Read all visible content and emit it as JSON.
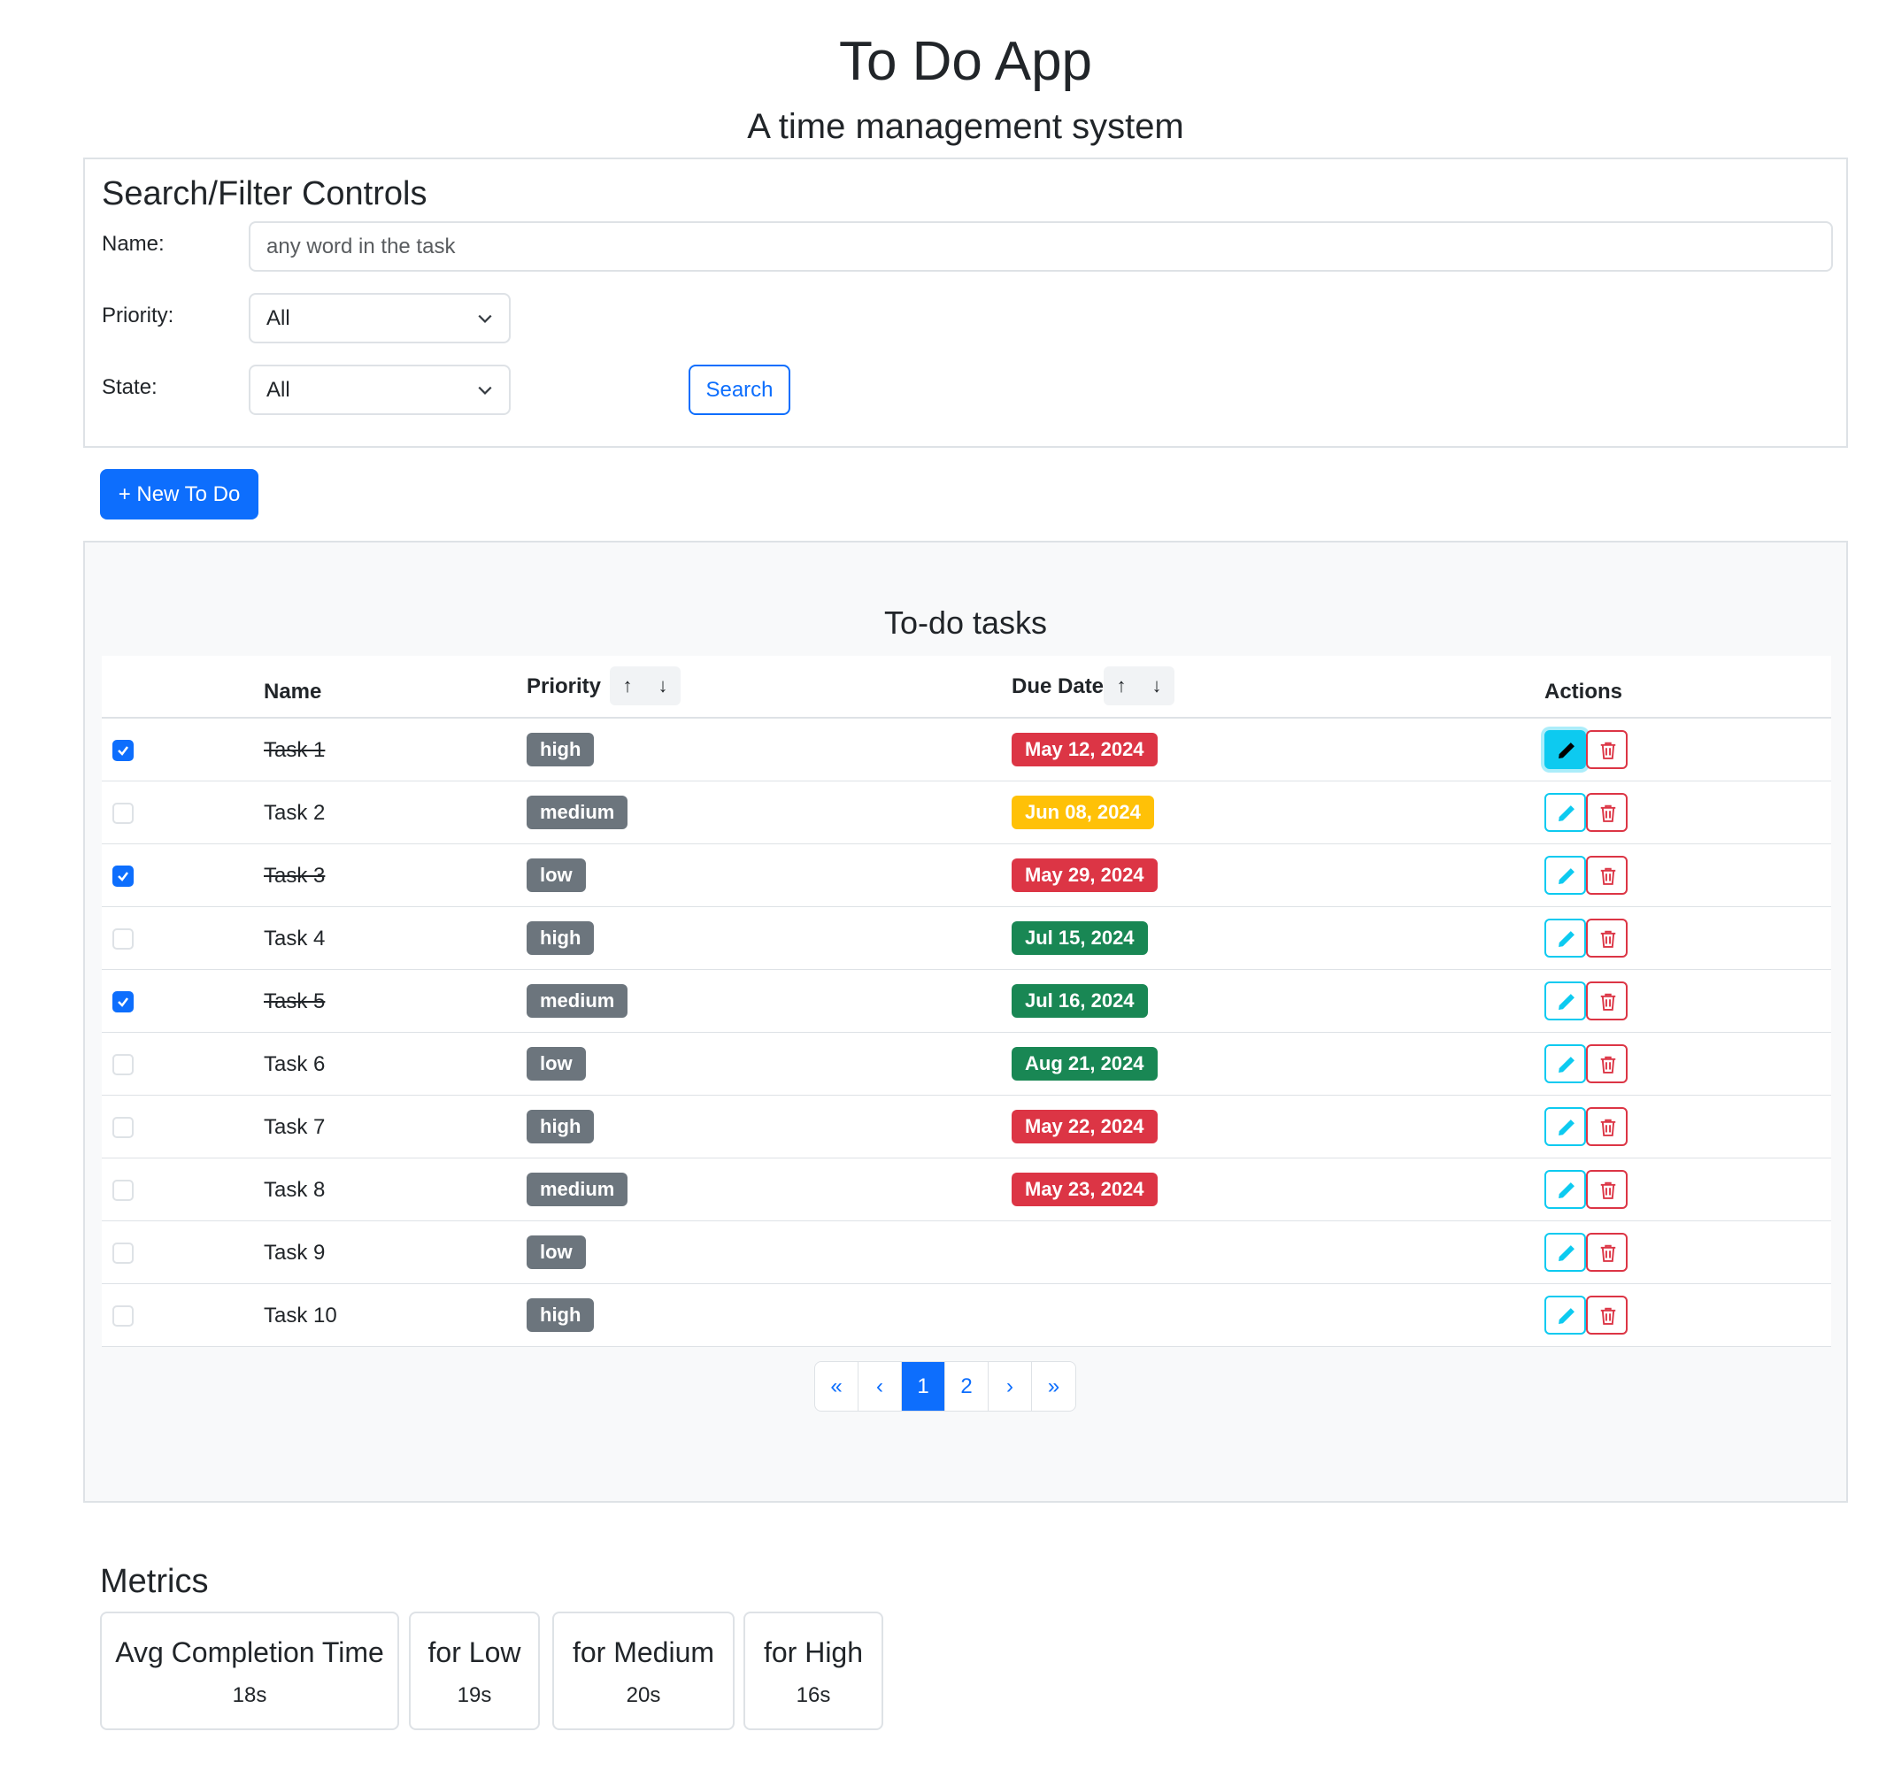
{
  "header": {
    "title": "To Do App",
    "subtitle": "A time management system"
  },
  "filters": {
    "title": "Search/Filter Controls",
    "name_label": "Name:",
    "name_placeholder": "any word in the task",
    "priority_label": "Priority:",
    "priority_value": "All",
    "state_label": "State:",
    "state_value": "All",
    "search_button": "Search"
  },
  "new_button": "+ New To Do",
  "tasks": {
    "title": "To-do tasks",
    "columns": {
      "name": "Name",
      "priority": "Priority",
      "due_date": "Due Date",
      "actions": "Actions"
    },
    "sort_up": "↑",
    "sort_down": "↓",
    "rows": [
      {
        "done": true,
        "name": "Task 1",
        "priority": "high",
        "due": "May 12, 2024",
        "due_color": "#dc3545",
        "due_text_color": "#ffffff",
        "edit_active": true
      },
      {
        "done": false,
        "name": "Task 2",
        "priority": "medium",
        "due": "Jun 08, 2024",
        "due_color": "#ffc107",
        "due_text_color": "#ffffff",
        "edit_active": false
      },
      {
        "done": true,
        "name": "Task 3",
        "priority": "low",
        "due": "May 29, 2024",
        "due_color": "#dc3545",
        "due_text_color": "#ffffff",
        "edit_active": false
      },
      {
        "done": false,
        "name": "Task 4",
        "priority": "high",
        "due": "Jul 15, 2024",
        "due_color": "#198754",
        "due_text_color": "#ffffff",
        "edit_active": false
      },
      {
        "done": true,
        "name": "Task 5",
        "priority": "medium",
        "due": "Jul 16, 2024",
        "due_color": "#198754",
        "due_text_color": "#ffffff",
        "edit_active": false
      },
      {
        "done": false,
        "name": "Task 6",
        "priority": "low",
        "due": "Aug 21, 2024",
        "due_color": "#198754",
        "due_text_color": "#ffffff",
        "edit_active": false
      },
      {
        "done": false,
        "name": "Task 7",
        "priority": "high",
        "due": "May 22, 2024",
        "due_color": "#dc3545",
        "due_text_color": "#ffffff",
        "edit_active": false
      },
      {
        "done": false,
        "name": "Task 8",
        "priority": "medium",
        "due": "May 23, 2024",
        "due_color": "#dc3545",
        "due_text_color": "#ffffff",
        "edit_active": false
      },
      {
        "done": false,
        "name": "Task 9",
        "priority": "low",
        "due": "",
        "due_color": "",
        "due_text_color": "",
        "edit_active": false
      },
      {
        "done": false,
        "name": "Task 10",
        "priority": "high",
        "due": "",
        "due_color": "",
        "due_text_color": "",
        "edit_active": false
      }
    ]
  },
  "pagination": {
    "items": [
      {
        "label": "«",
        "active": false
      },
      {
        "label": "‹",
        "active": false
      },
      {
        "label": "1",
        "active": true
      },
      {
        "label": "2",
        "active": false
      },
      {
        "label": "›",
        "active": false
      },
      {
        "label": "»",
        "active": false
      }
    ]
  },
  "metrics": {
    "title": "Metrics",
    "cards": [
      {
        "label": "Avg Completion Time",
        "value": "18s"
      },
      {
        "label": "for Low",
        "value": "19s"
      },
      {
        "label": "for Medium",
        "value": "20s"
      },
      {
        "label": "for High",
        "value": "16s"
      }
    ]
  },
  "colors": {
    "primary": "#0d6efd",
    "info": "#0dcaf0",
    "danger": "#dc3545",
    "warning": "#ffc107",
    "success": "#198754",
    "secondary": "#6c757d"
  },
  "icons": {
    "edit": "pencil-icon",
    "delete": "trash-icon",
    "checkbox": "check-icon",
    "select": "chevron-down-icon"
  }
}
